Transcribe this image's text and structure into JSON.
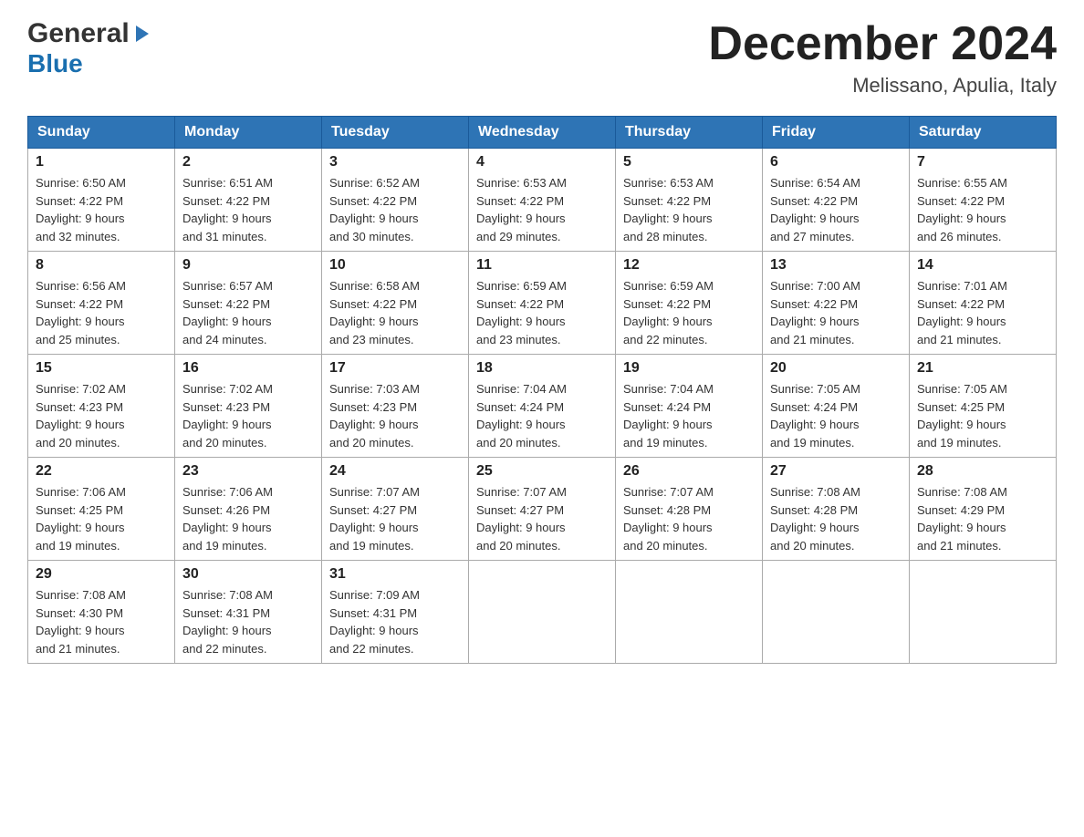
{
  "header": {
    "logo_general": "General",
    "logo_blue": "Blue",
    "month_title": "December 2024",
    "location": "Melissano, Apulia, Italy"
  },
  "weekdays": [
    "Sunday",
    "Monday",
    "Tuesday",
    "Wednesday",
    "Thursday",
    "Friday",
    "Saturday"
  ],
  "weeks": [
    [
      {
        "day": "1",
        "sunrise": "6:50 AM",
        "sunset": "4:22 PM",
        "daylight": "9 hours and 32 minutes."
      },
      {
        "day": "2",
        "sunrise": "6:51 AM",
        "sunset": "4:22 PM",
        "daylight": "9 hours and 31 minutes."
      },
      {
        "day": "3",
        "sunrise": "6:52 AM",
        "sunset": "4:22 PM",
        "daylight": "9 hours and 30 minutes."
      },
      {
        "day": "4",
        "sunrise": "6:53 AM",
        "sunset": "4:22 PM",
        "daylight": "9 hours and 29 minutes."
      },
      {
        "day": "5",
        "sunrise": "6:53 AM",
        "sunset": "4:22 PM",
        "daylight": "9 hours and 28 minutes."
      },
      {
        "day": "6",
        "sunrise": "6:54 AM",
        "sunset": "4:22 PM",
        "daylight": "9 hours and 27 minutes."
      },
      {
        "day": "7",
        "sunrise": "6:55 AM",
        "sunset": "4:22 PM",
        "daylight": "9 hours and 26 minutes."
      }
    ],
    [
      {
        "day": "8",
        "sunrise": "6:56 AM",
        "sunset": "4:22 PM",
        "daylight": "9 hours and 25 minutes."
      },
      {
        "day": "9",
        "sunrise": "6:57 AM",
        "sunset": "4:22 PM",
        "daylight": "9 hours and 24 minutes."
      },
      {
        "day": "10",
        "sunrise": "6:58 AM",
        "sunset": "4:22 PM",
        "daylight": "9 hours and 23 minutes."
      },
      {
        "day": "11",
        "sunrise": "6:59 AM",
        "sunset": "4:22 PM",
        "daylight": "9 hours and 23 minutes."
      },
      {
        "day": "12",
        "sunrise": "6:59 AM",
        "sunset": "4:22 PM",
        "daylight": "9 hours and 22 minutes."
      },
      {
        "day": "13",
        "sunrise": "7:00 AM",
        "sunset": "4:22 PM",
        "daylight": "9 hours and 21 minutes."
      },
      {
        "day": "14",
        "sunrise": "7:01 AM",
        "sunset": "4:22 PM",
        "daylight": "9 hours and 21 minutes."
      }
    ],
    [
      {
        "day": "15",
        "sunrise": "7:02 AM",
        "sunset": "4:23 PM",
        "daylight": "9 hours and 20 minutes."
      },
      {
        "day": "16",
        "sunrise": "7:02 AM",
        "sunset": "4:23 PM",
        "daylight": "9 hours and 20 minutes."
      },
      {
        "day": "17",
        "sunrise": "7:03 AM",
        "sunset": "4:23 PM",
        "daylight": "9 hours and 20 minutes."
      },
      {
        "day": "18",
        "sunrise": "7:04 AM",
        "sunset": "4:24 PM",
        "daylight": "9 hours and 20 minutes."
      },
      {
        "day": "19",
        "sunrise": "7:04 AM",
        "sunset": "4:24 PM",
        "daylight": "9 hours and 19 minutes."
      },
      {
        "day": "20",
        "sunrise": "7:05 AM",
        "sunset": "4:24 PM",
        "daylight": "9 hours and 19 minutes."
      },
      {
        "day": "21",
        "sunrise": "7:05 AM",
        "sunset": "4:25 PM",
        "daylight": "9 hours and 19 minutes."
      }
    ],
    [
      {
        "day": "22",
        "sunrise": "7:06 AM",
        "sunset": "4:25 PM",
        "daylight": "9 hours and 19 minutes."
      },
      {
        "day": "23",
        "sunrise": "7:06 AM",
        "sunset": "4:26 PM",
        "daylight": "9 hours and 19 minutes."
      },
      {
        "day": "24",
        "sunrise": "7:07 AM",
        "sunset": "4:27 PM",
        "daylight": "9 hours and 19 minutes."
      },
      {
        "day": "25",
        "sunrise": "7:07 AM",
        "sunset": "4:27 PM",
        "daylight": "9 hours and 20 minutes."
      },
      {
        "day": "26",
        "sunrise": "7:07 AM",
        "sunset": "4:28 PM",
        "daylight": "9 hours and 20 minutes."
      },
      {
        "day": "27",
        "sunrise": "7:08 AM",
        "sunset": "4:28 PM",
        "daylight": "9 hours and 20 minutes."
      },
      {
        "day": "28",
        "sunrise": "7:08 AM",
        "sunset": "4:29 PM",
        "daylight": "9 hours and 21 minutes."
      }
    ],
    [
      {
        "day": "29",
        "sunrise": "7:08 AM",
        "sunset": "4:30 PM",
        "daylight": "9 hours and 21 minutes."
      },
      {
        "day": "30",
        "sunrise": "7:08 AM",
        "sunset": "4:31 PM",
        "daylight": "9 hours and 22 minutes."
      },
      {
        "day": "31",
        "sunrise": "7:09 AM",
        "sunset": "4:31 PM",
        "daylight": "9 hours and 22 minutes."
      },
      null,
      null,
      null,
      null
    ]
  ],
  "labels": {
    "sunrise": "Sunrise:",
    "sunset": "Sunset:",
    "daylight": "Daylight:"
  }
}
